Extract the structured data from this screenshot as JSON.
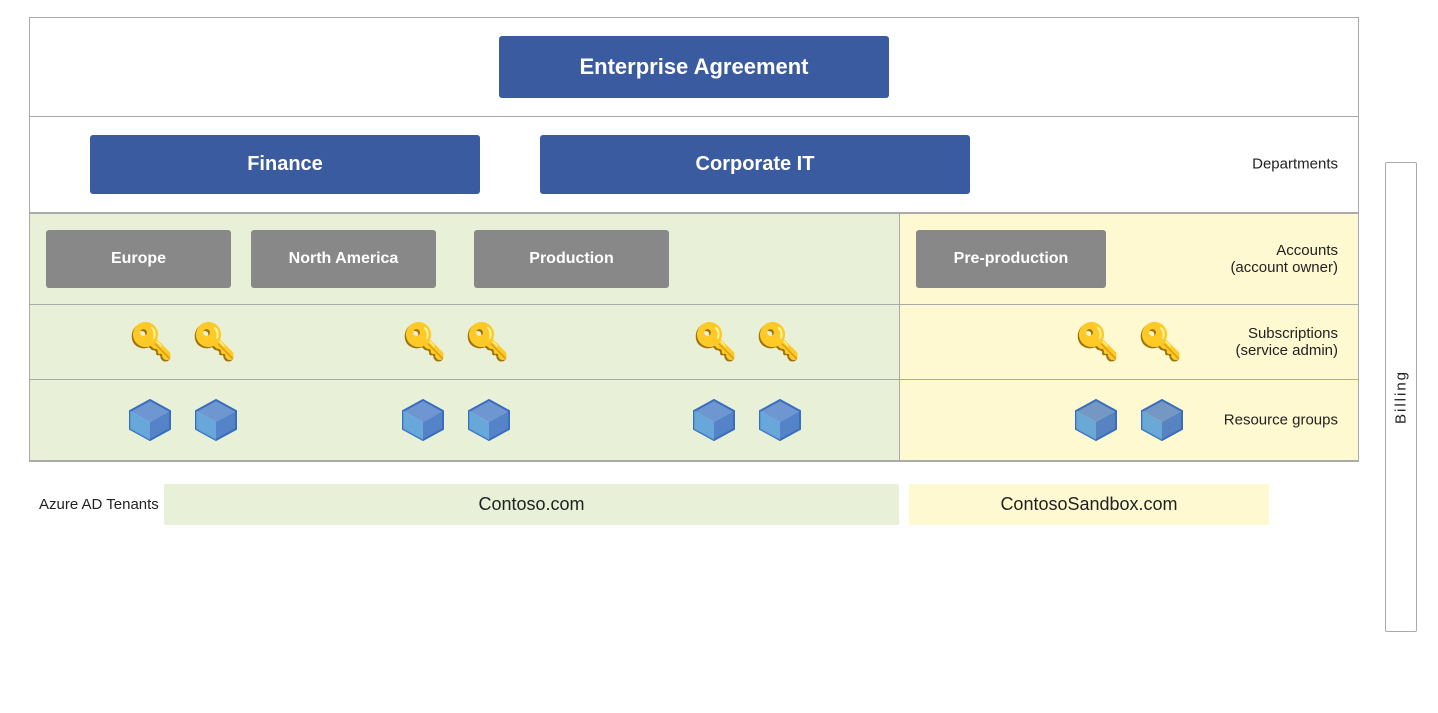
{
  "diagram": {
    "enterprise_agreement": "Enterprise Agreement",
    "departments": {
      "label": "Departments",
      "finance": "Finance",
      "corporate_it": "Corporate IT"
    },
    "accounts": {
      "label_line1": "Accounts",
      "label_line2": "(account owner)",
      "europe": "Europe",
      "north_america": "North America",
      "production": "Production",
      "pre_production": "Pre-production"
    },
    "subscriptions": {
      "label_line1": "Subscriptions",
      "label_line2": "(service admin)"
    },
    "resource_groups": {
      "label": "Resource groups"
    },
    "azure_ad": {
      "label": "Azure AD Tenants",
      "contoso": "Contoso.com",
      "contoso_sandbox": "ContosoSandbox.com"
    },
    "billing": "Billing"
  }
}
